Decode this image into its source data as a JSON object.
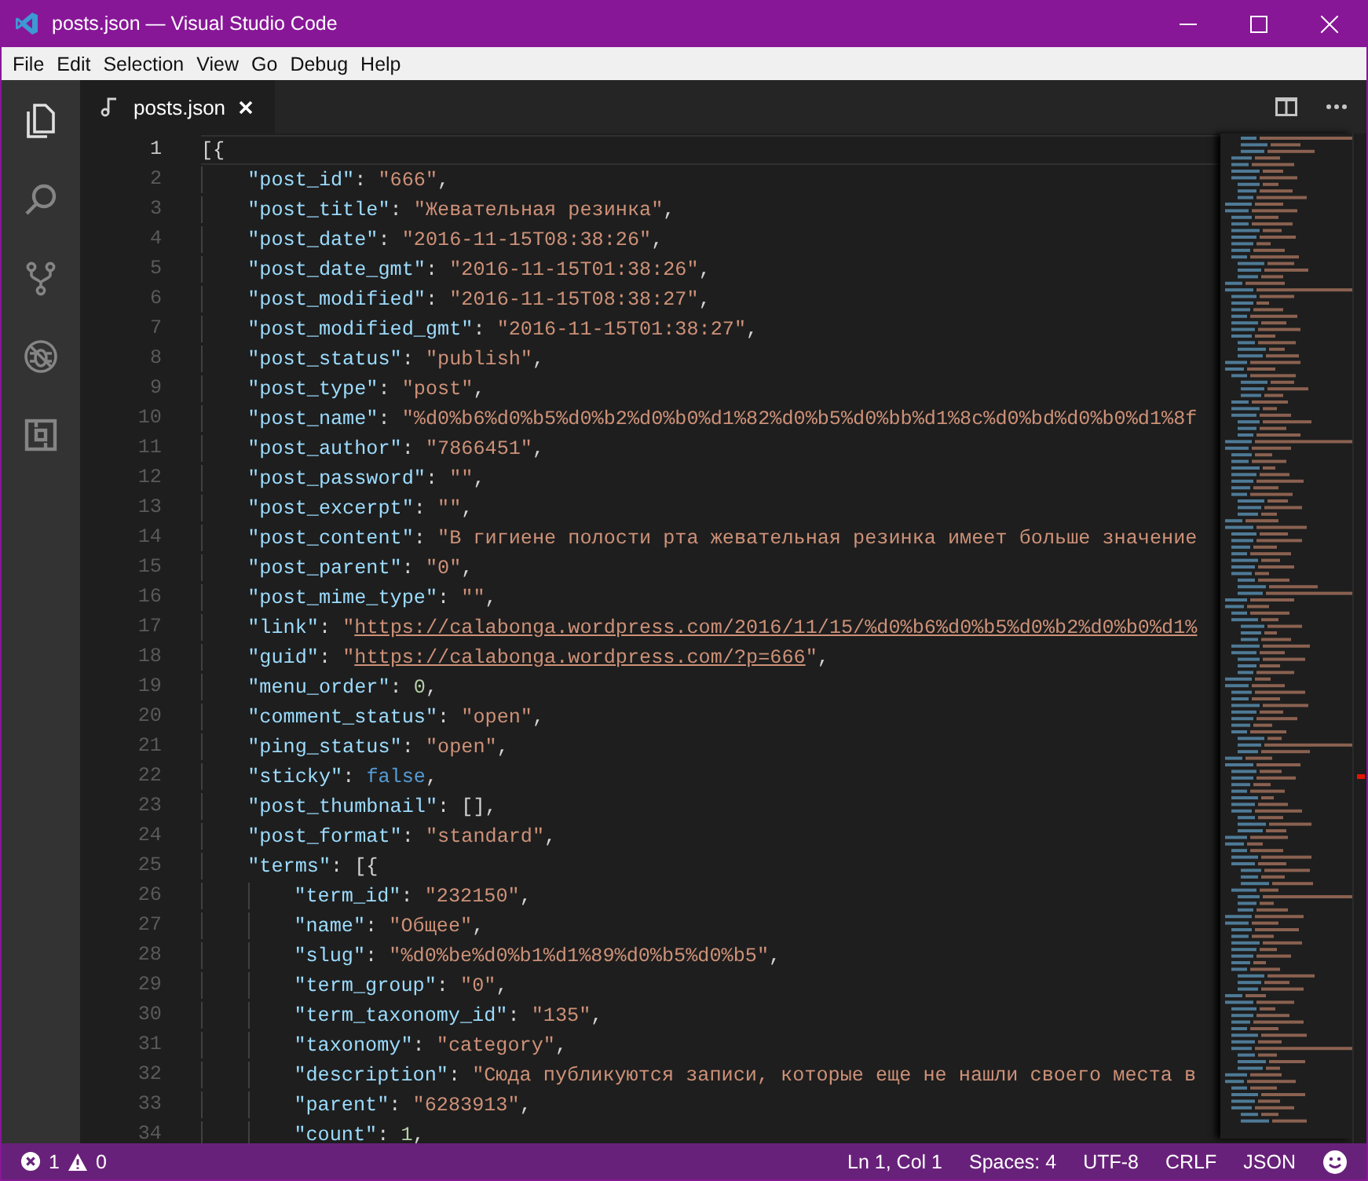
{
  "window": {
    "title": "posts.json — Visual Studio Code"
  },
  "menu": [
    "File",
    "Edit",
    "Selection",
    "View",
    "Go",
    "Debug",
    "Help"
  ],
  "activity_bar": [
    {
      "kind": "explorer",
      "selected": true
    },
    {
      "kind": "search",
      "selected": false
    },
    {
      "kind": "git",
      "selected": false
    },
    {
      "kind": "debug",
      "selected": false
    },
    {
      "kind": "extensions",
      "selected": false
    }
  ],
  "tabs": [
    {
      "label": "posts.json",
      "selected": true
    }
  ],
  "editor": {
    "lines": [
      {
        "number": "1",
        "current": true,
        "tokens": [
          {
            "kind": "punct",
            "text": "[{"
          }
        ],
        "children": [
          {
            "number": "2",
            "current": false,
            "tokens": [
              {
                "kind": "key",
                "text": "\"post_id\""
              },
              {
                "kind": "punct",
                "text": ": "
              },
              {
                "kind": "string",
                "text": "\"666\""
              },
              {
                "kind": "punct",
                "text": ","
              }
            ]
          },
          {
            "number": "3",
            "current": false,
            "tokens": [
              {
                "kind": "key",
                "text": "\"post_title\""
              },
              {
                "kind": "punct",
                "text": ": "
              },
              {
                "kind": "string",
                "text": "\"Жевательная резинка\""
              },
              {
                "kind": "punct",
                "text": ","
              }
            ]
          },
          {
            "number": "4",
            "current": false,
            "tokens": [
              {
                "kind": "key",
                "text": "\"post_date\""
              },
              {
                "kind": "punct",
                "text": ": "
              },
              {
                "kind": "string",
                "text": "\"2016-11-15T08:38:26\""
              },
              {
                "kind": "punct",
                "text": ","
              }
            ]
          },
          {
            "number": "5",
            "current": false,
            "tokens": [
              {
                "kind": "key",
                "text": "\"post_date_gmt\""
              },
              {
                "kind": "punct",
                "text": ": "
              },
              {
                "kind": "string",
                "text": "\"2016-11-15T01:38:26\""
              },
              {
                "kind": "punct",
                "text": ","
              }
            ]
          },
          {
            "number": "6",
            "current": false,
            "tokens": [
              {
                "kind": "key",
                "text": "\"post_modified\""
              },
              {
                "kind": "punct",
                "text": ": "
              },
              {
                "kind": "string",
                "text": "\"2016-11-15T08:38:27\""
              },
              {
                "kind": "punct",
                "text": ","
              }
            ]
          },
          {
            "number": "7",
            "current": false,
            "tokens": [
              {
                "kind": "key",
                "text": "\"post_modified_gmt\""
              },
              {
                "kind": "punct",
                "text": ": "
              },
              {
                "kind": "string",
                "text": "\"2016-11-15T01:38:27\""
              },
              {
                "kind": "punct",
                "text": ","
              }
            ]
          },
          {
            "number": "8",
            "current": false,
            "tokens": [
              {
                "kind": "key",
                "text": "\"post_status\""
              },
              {
                "kind": "punct",
                "text": ": "
              },
              {
                "kind": "string",
                "text": "\"publish\""
              },
              {
                "kind": "punct",
                "text": ","
              }
            ]
          },
          {
            "number": "9",
            "current": false,
            "tokens": [
              {
                "kind": "key",
                "text": "\"post_type\""
              },
              {
                "kind": "punct",
                "text": ": "
              },
              {
                "kind": "string",
                "text": "\"post\""
              },
              {
                "kind": "punct",
                "text": ","
              }
            ]
          },
          {
            "number": "10",
            "current": false,
            "tokens": [
              {
                "kind": "key",
                "text": "\"post_name\""
              },
              {
                "kind": "punct",
                "text": ": "
              },
              {
                "kind": "string",
                "text": "\"%d0%b6%d0%b5%d0%b2%d0%b0%d1%82%d0%b5%d0%bb%d1%8c%d0%bd%d0%b0%d1%8f"
              }
            ]
          },
          {
            "number": "11",
            "current": false,
            "tokens": [
              {
                "kind": "key",
                "text": "\"post_author\""
              },
              {
                "kind": "punct",
                "text": ": "
              },
              {
                "kind": "string",
                "text": "\"7866451\""
              },
              {
                "kind": "punct",
                "text": ","
              }
            ]
          },
          {
            "number": "12",
            "current": false,
            "tokens": [
              {
                "kind": "key",
                "text": "\"post_password\""
              },
              {
                "kind": "punct",
                "text": ": "
              },
              {
                "kind": "string",
                "text": "\"\""
              },
              {
                "kind": "punct",
                "text": ","
              }
            ]
          },
          {
            "number": "13",
            "current": false,
            "tokens": [
              {
                "kind": "key",
                "text": "\"post_excerpt\""
              },
              {
                "kind": "punct",
                "text": ": "
              },
              {
                "kind": "string",
                "text": "\"\""
              },
              {
                "kind": "punct",
                "text": ","
              }
            ]
          },
          {
            "number": "14",
            "current": false,
            "tokens": [
              {
                "kind": "key",
                "text": "\"post_content\""
              },
              {
                "kind": "punct",
                "text": ": "
              },
              {
                "kind": "string",
                "text": "\"В гигиене полости рта жевательная резинка имеет больше значение"
              }
            ]
          },
          {
            "number": "15",
            "current": false,
            "tokens": [
              {
                "kind": "key",
                "text": "\"post_parent\""
              },
              {
                "kind": "punct",
                "text": ": "
              },
              {
                "kind": "string",
                "text": "\"0\""
              },
              {
                "kind": "punct",
                "text": ","
              }
            ]
          },
          {
            "number": "16",
            "current": false,
            "tokens": [
              {
                "kind": "key",
                "text": "\"post_mime_type\""
              },
              {
                "kind": "punct",
                "text": ": "
              },
              {
                "kind": "string",
                "text": "\"\""
              },
              {
                "kind": "punct",
                "text": ","
              }
            ]
          },
          {
            "number": "17",
            "current": false,
            "tokens": [
              {
                "kind": "key",
                "text": "\"link\""
              },
              {
                "kind": "punct",
                "text": ": "
              },
              {
                "kind": "string",
                "text": "\""
              },
              {
                "kind": "link",
                "text": "https://calabonga.wordpress.com/2016/11/15/%d0%b6%d0%b5%d0%b2%d0%b0%d1%"
              }
            ]
          },
          {
            "number": "18",
            "current": false,
            "tokens": [
              {
                "kind": "key",
                "text": "\"guid\""
              },
              {
                "kind": "punct",
                "text": ": "
              },
              {
                "kind": "string",
                "text": "\""
              },
              {
                "kind": "link",
                "text": "https://calabonga.wordpress.com/?p=666"
              },
              {
                "kind": "string",
                "text": "\""
              },
              {
                "kind": "punct",
                "text": ","
              }
            ]
          },
          {
            "number": "19",
            "current": false,
            "tokens": [
              {
                "kind": "key",
                "text": "\"menu_order\""
              },
              {
                "kind": "punct",
                "text": ": "
              },
              {
                "kind": "number",
                "text": "0"
              },
              {
                "kind": "punct",
                "text": ","
              }
            ]
          },
          {
            "number": "20",
            "current": false,
            "tokens": [
              {
                "kind": "key",
                "text": "\"comment_status\""
              },
              {
                "kind": "punct",
                "text": ": "
              },
              {
                "kind": "string",
                "text": "\"open\""
              },
              {
                "kind": "punct",
                "text": ","
              }
            ]
          },
          {
            "number": "21",
            "current": false,
            "tokens": [
              {
                "kind": "key",
                "text": "\"ping_status\""
              },
              {
                "kind": "punct",
                "text": ": "
              },
              {
                "kind": "string",
                "text": "\"open\""
              },
              {
                "kind": "punct",
                "text": ","
              }
            ]
          },
          {
            "number": "22",
            "current": false,
            "tokens": [
              {
                "kind": "key",
                "text": "\"sticky\""
              },
              {
                "kind": "punct",
                "text": ": "
              },
              {
                "kind": "bool",
                "text": "false"
              },
              {
                "kind": "punct",
                "text": ","
              }
            ]
          },
          {
            "number": "23",
            "current": false,
            "tokens": [
              {
                "kind": "key",
                "text": "\"post_thumbnail\""
              },
              {
                "kind": "punct",
                "text": ": [],"
              }
            ]
          },
          {
            "number": "24",
            "current": false,
            "tokens": [
              {
                "kind": "key",
                "text": "\"post_format\""
              },
              {
                "kind": "punct",
                "text": ": "
              },
              {
                "kind": "string",
                "text": "\"standard\""
              },
              {
                "kind": "punct",
                "text": ","
              }
            ]
          },
          {
            "number": "25",
            "current": false,
            "tokens": [
              {
                "kind": "key",
                "text": "\"terms\""
              },
              {
                "kind": "punct",
                "text": ": [{"
              }
            ],
            "children": [
              {
                "number": "26",
                "current": false,
                "tokens": [
                  {
                    "kind": "key",
                    "text": "\"term_id\""
                  },
                  {
                    "kind": "punct",
                    "text": ": "
                  },
                  {
                    "kind": "string",
                    "text": "\"232150\""
                  },
                  {
                    "kind": "punct",
                    "text": ","
                  }
                ]
              },
              {
                "number": "27",
                "current": false,
                "tokens": [
                  {
                    "kind": "key",
                    "text": "\"name\""
                  },
                  {
                    "kind": "punct",
                    "text": ": "
                  },
                  {
                    "kind": "string",
                    "text": "\"Общее\""
                  },
                  {
                    "kind": "punct",
                    "text": ","
                  }
                ]
              },
              {
                "number": "28",
                "current": false,
                "tokens": [
                  {
                    "kind": "key",
                    "text": "\"slug\""
                  },
                  {
                    "kind": "punct",
                    "text": ": "
                  },
                  {
                    "kind": "string",
                    "text": "\"%d0%be%d0%b1%d1%89%d0%b5%d0%b5\""
                  },
                  {
                    "kind": "punct",
                    "text": ","
                  }
                ]
              },
              {
                "number": "29",
                "current": false,
                "tokens": [
                  {
                    "kind": "key",
                    "text": "\"term_group\""
                  },
                  {
                    "kind": "punct",
                    "text": ": "
                  },
                  {
                    "kind": "string",
                    "text": "\"0\""
                  },
                  {
                    "kind": "punct",
                    "text": ","
                  }
                ]
              },
              {
                "number": "30",
                "current": false,
                "tokens": [
                  {
                    "kind": "key",
                    "text": "\"term_taxonomy_id\""
                  },
                  {
                    "kind": "punct",
                    "text": ": "
                  },
                  {
                    "kind": "string",
                    "text": "\"135\""
                  },
                  {
                    "kind": "punct",
                    "text": ","
                  }
                ]
              },
              {
                "number": "31",
                "current": false,
                "tokens": [
                  {
                    "kind": "key",
                    "text": "\"taxonomy\""
                  },
                  {
                    "kind": "punct",
                    "text": ": "
                  },
                  {
                    "kind": "string",
                    "text": "\"category\""
                  },
                  {
                    "kind": "punct",
                    "text": ","
                  }
                ]
              },
              {
                "number": "32",
                "current": false,
                "tokens": [
                  {
                    "kind": "key",
                    "text": "\"description\""
                  },
                  {
                    "kind": "punct",
                    "text": ": "
                  },
                  {
                    "kind": "string",
                    "text": "\"Сюда публикуются записи, которые еще не нашли своего места в"
                  }
                ]
              },
              {
                "number": "33",
                "current": false,
                "tokens": [
                  {
                    "kind": "key",
                    "text": "\"parent\""
                  },
                  {
                    "kind": "punct",
                    "text": ": "
                  },
                  {
                    "kind": "string",
                    "text": "\"6283913\""
                  },
                  {
                    "kind": "punct",
                    "text": ","
                  }
                ]
              },
              {
                "number": "34",
                "current": false,
                "tokens": [
                  {
                    "kind": "key",
                    "text": "\"count\""
                  },
                  {
                    "kind": "punct",
                    "text": ": "
                  },
                  {
                    "kind": "number",
                    "text": "1"
                  },
                  {
                    "kind": "punct",
                    "text": ","
                  }
                ]
              }
            ]
          }
        ]
      }
    ]
  },
  "status_bar": {
    "errors": "1",
    "warnings": "0",
    "items": [
      "Ln 1, Col 1",
      "Spaces: 4",
      "UTF-8",
      "CRLF",
      "JSON"
    ]
  }
}
